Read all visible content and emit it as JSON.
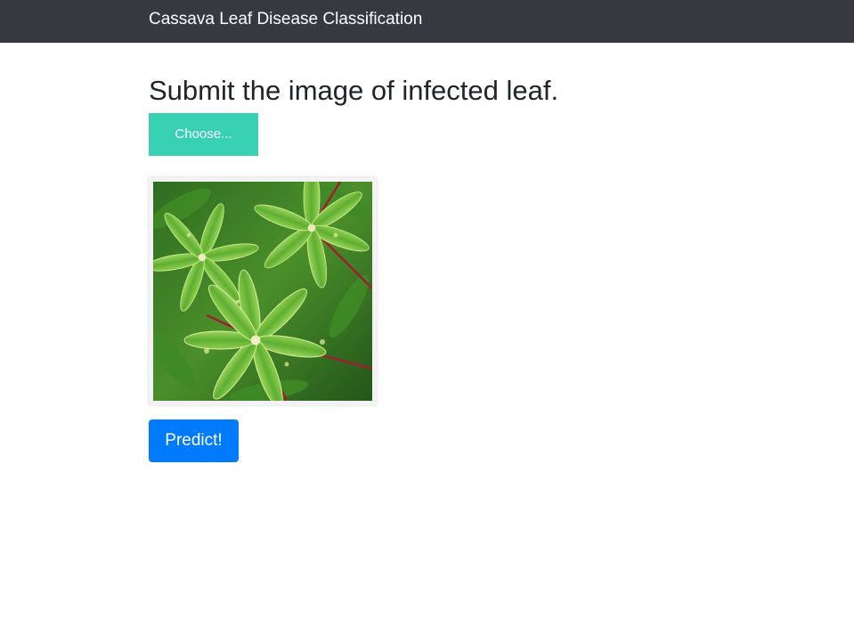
{
  "navbar": {
    "brand": "Cassava Leaf Disease Classification",
    "background_color": "#343a40"
  },
  "main": {
    "title": "Submit the image of infected leaf.",
    "file_button": {
      "label": "Choose...",
      "color": "#39d1b4"
    },
    "preview_image": {
      "alt": "cassava leaf image",
      "icon": "leaf-photo"
    },
    "predict_button": {
      "label": "Predict!",
      "color": "#007bff"
    }
  }
}
